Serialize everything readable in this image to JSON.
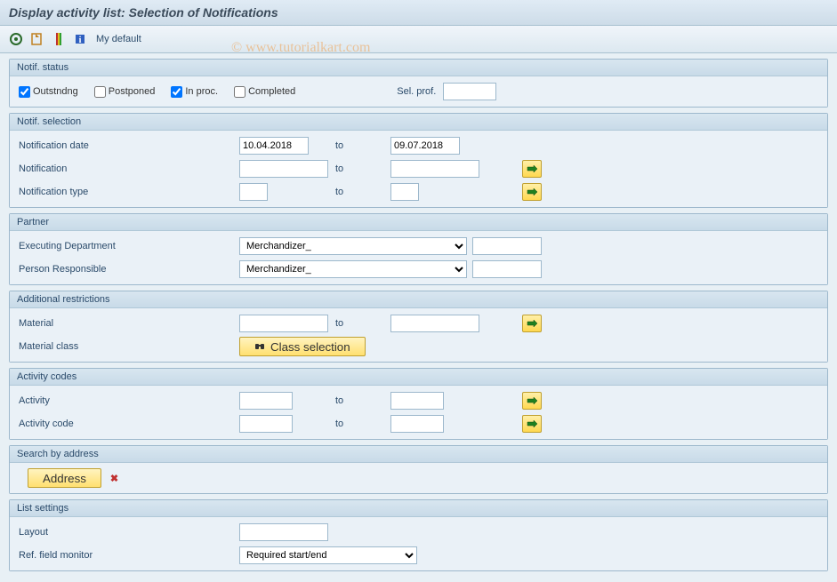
{
  "title": "Display activity list: Selection of Notifications",
  "watermark": "© www.tutorialkart.com",
  "toolbar": {
    "my_default": "My default"
  },
  "groups": {
    "notif_status": {
      "title": "Notif. status",
      "outstanding_label": "Outstndng",
      "outstanding_checked": true,
      "postponed_label": "Postponed",
      "postponed_checked": false,
      "in_proc_label": "In proc.",
      "in_proc_checked": true,
      "completed_label": "Completed",
      "completed_checked": false,
      "sel_prof_label": "Sel. prof.",
      "sel_prof_value": ""
    },
    "notif_selection": {
      "title": "Notif. selection",
      "date_label": "Notification date",
      "date_from": "10.04.2018",
      "date_to": "09.07.2018",
      "notif_label": "Notification",
      "notif_from": "",
      "notif_to": "",
      "type_label": "Notification type",
      "type_from": "",
      "type_to": "",
      "to_label": "to"
    },
    "partner": {
      "title": "Partner",
      "exec_dept_label": "Executing Department",
      "exec_dept_value": "Merchandizer_",
      "person_resp_label": "Person Responsible",
      "person_resp_value": "Merchandizer_"
    },
    "additional": {
      "title": "Additional restrictions",
      "material_label": "Material",
      "material_from": "",
      "material_to": "",
      "to_label": "to",
      "material_class_label": "Material class",
      "class_selection_btn": "Class selection"
    },
    "activity_codes": {
      "title": "Activity codes",
      "activity_label": "Activity",
      "activity_from": "",
      "activity_to": "",
      "code_label": "Activity code",
      "code_from": "",
      "code_to": "",
      "to_label": "to"
    },
    "address": {
      "title": "Search by address",
      "address_btn": "Address"
    },
    "list_settings": {
      "title": "List settings",
      "layout_label": "Layout",
      "layout_value": "",
      "ref_monitor_label": "Ref. field monitor",
      "ref_monitor_value": "Required start/end"
    }
  }
}
